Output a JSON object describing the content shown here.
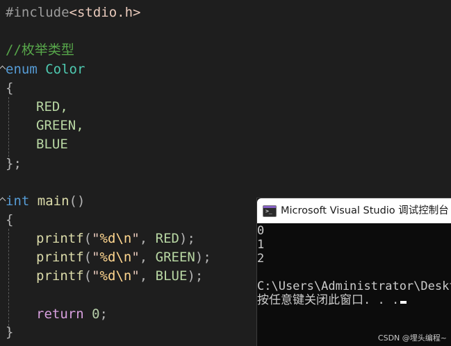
{
  "editor": {
    "include": {
      "directive": "#include",
      "header": "<stdio.h>"
    },
    "comment": "//枚举类型",
    "enum_decl": {
      "keyword": "enum",
      "name": "Color"
    },
    "open_brace": "{",
    "enumerators": [
      "RED,",
      "GREEN,",
      "BLUE"
    ],
    "close_brace_semicolon": "};",
    "main_decl": {
      "type": "int",
      "name": "main",
      "params": "()"
    },
    "main_open": "{",
    "printf_lines": [
      {
        "fn": "printf",
        "open": "(",
        "q1": "\"",
        "fmt": "%d",
        "esc": "\\n",
        "q2": "\"",
        "arg": "RED",
        "close": ");"
      },
      {
        "fn": "printf",
        "open": "(",
        "q1": "\"",
        "fmt": "%d",
        "esc": "\\n",
        "q2": "\"",
        "arg": "GREEN",
        "close": ");"
      },
      {
        "fn": "printf",
        "open": "(",
        "q1": "\"",
        "fmt": "%d",
        "esc": "\\n",
        "q2": "\"",
        "arg": "BLUE",
        "close": ");"
      }
    ],
    "return_stmt": {
      "keyword": "return",
      "value": "0",
      "end": ";"
    },
    "main_close": "}"
  },
  "console": {
    "title": "Microsoft Visual Studio 调试控制台",
    "output": [
      "0",
      "1",
      "2"
    ],
    "path": "C:\\Users\\Administrator\\Deskt",
    "prompt": "按任意键关闭此窗口. . ."
  },
  "watermark": "CSDN @埋头编程~",
  "colors": {
    "background": "#1e1e1e",
    "keyword": "#569cd6",
    "type_name": "#4ec9b0",
    "comment": "#57a64a",
    "string": "#e8c9bb",
    "enum_member": "#b8d7a3",
    "function": "#dcdcaa",
    "control_keyword": "#d8a0df",
    "console_accent": "#8661c5"
  }
}
